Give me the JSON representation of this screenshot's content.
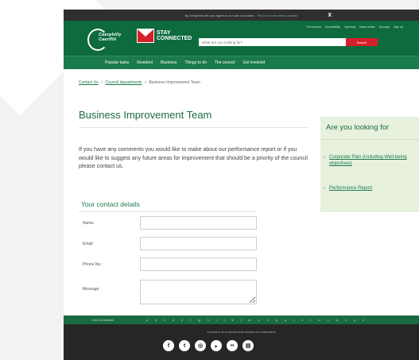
{
  "cookie_bar": {
    "text": "By using this site you agree to our use of cookies",
    "link": "Find out more about cookies",
    "close": "X"
  },
  "header": {
    "logo_text_1": "Caerphilly",
    "logo_text_2": "Caerffili",
    "stay_connected_1": "STAY",
    "stay_connected_2": "CONNECTED",
    "util_links": [
      "Get in touch",
      "Accessibility",
      "Cymraeg",
      "News centre",
      "My page",
      "Sign up"
    ],
    "search_placeholder": "What are you looking for?",
    "search_button": "Search"
  },
  "nav": {
    "items": [
      "Popular tasks",
      "Resident",
      "Business",
      "Things to do",
      "The council",
      "Get involved"
    ]
  },
  "breadcrumb": {
    "items": [
      "Contact Us",
      "Council departments",
      "Business Improvement Team"
    ]
  },
  "main": {
    "title": "Business Improvement Team",
    "intro": "If you have any comments you would like to make about our performance report or if you would like to suggest any future areas for improvement that should be a priority of the council please contact us."
  },
  "form": {
    "title": "Your contact details",
    "fields": [
      {
        "label": "Name:"
      },
      {
        "label": "Email:"
      },
      {
        "label": "Phone No.:"
      },
      {
        "label": "Message:"
      }
    ]
  },
  "sidebar": {
    "title": "Are you looking for",
    "links": [
      "Corporate Plan (including Well-being objectives)",
      "Performance Report"
    ]
  },
  "footer": {
    "az_label": "A to Z of services",
    "letters": "a b c d e f g h i j k l m n o p q r s t u v w x y z",
    "connect": "Connect to us on social media and join the conversation",
    "social_icons": [
      "facebook-icon",
      "twitter-icon",
      "instagram-icon",
      "youtube-icon",
      "flickr-icon",
      "news-icon"
    ]
  }
}
